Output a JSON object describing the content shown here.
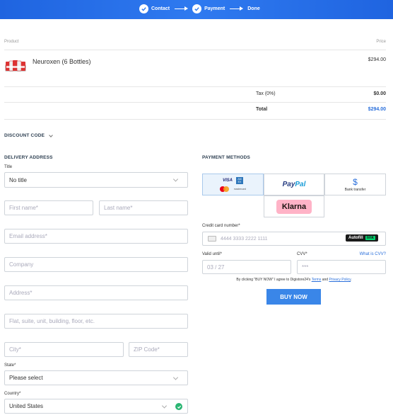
{
  "steps": [
    "Contact",
    "Payment",
    "Done"
  ],
  "table": {
    "product_header": "Product",
    "price_header": "Price"
  },
  "item": {
    "name": "Neuroxen (6 Bottles)",
    "price": "$294.00"
  },
  "tax": {
    "label": "Tax (0%)",
    "value": "$0.00"
  },
  "total": {
    "label": "Total",
    "value": "$294.00"
  },
  "discount": {
    "label": "DISCOUNT CODE"
  },
  "delivery": {
    "heading": "DELIVERY ADDRESS",
    "title_label": "Title",
    "title_value": "No title",
    "first_name": "First name*",
    "last_name": "Last name*",
    "email": "Email address*",
    "company": "Company",
    "address": "Address*",
    "address2": "Flat, suite, unit, building, floor, etc.",
    "city": "City*",
    "zip": "ZIP Code*",
    "state_label": "State*",
    "state_value": "Please select",
    "country_label": "Country*",
    "country_value": "United States"
  },
  "payment": {
    "heading": "PAYMENT METHODS",
    "visa": "VISA",
    "amex": "AM EX",
    "mastercard_text": "mastercard",
    "paypal_pay": "Pay",
    "paypal_pal": "Pal",
    "bank": "Bank transfer",
    "klarna": "Klarna",
    "card_label": "Credit card number*",
    "card_placeholder": "4444 3333 2222 1111",
    "autofill": "Autofill",
    "autofill_link": "link",
    "valid_label": "Valid until*",
    "valid_placeholder": "03 / 27",
    "cvv_label": "CVV*",
    "cvv_help": "What is CVV?",
    "cvv_placeholder": "***",
    "terms_prefix": "By clicking \"BUY NOW\" I agree to Digistore24's ",
    "terms": "Terms",
    "and": " and ",
    "privacy": "Privacy Policy",
    "period": ".",
    "buy": "BUY NOW"
  },
  "colors": {
    "brand": "#2f7af0",
    "button": "#3a86e8",
    "total": "#2a6fdb",
    "klarna_bg": "#ffb3c7",
    "check": "#2bb673"
  }
}
